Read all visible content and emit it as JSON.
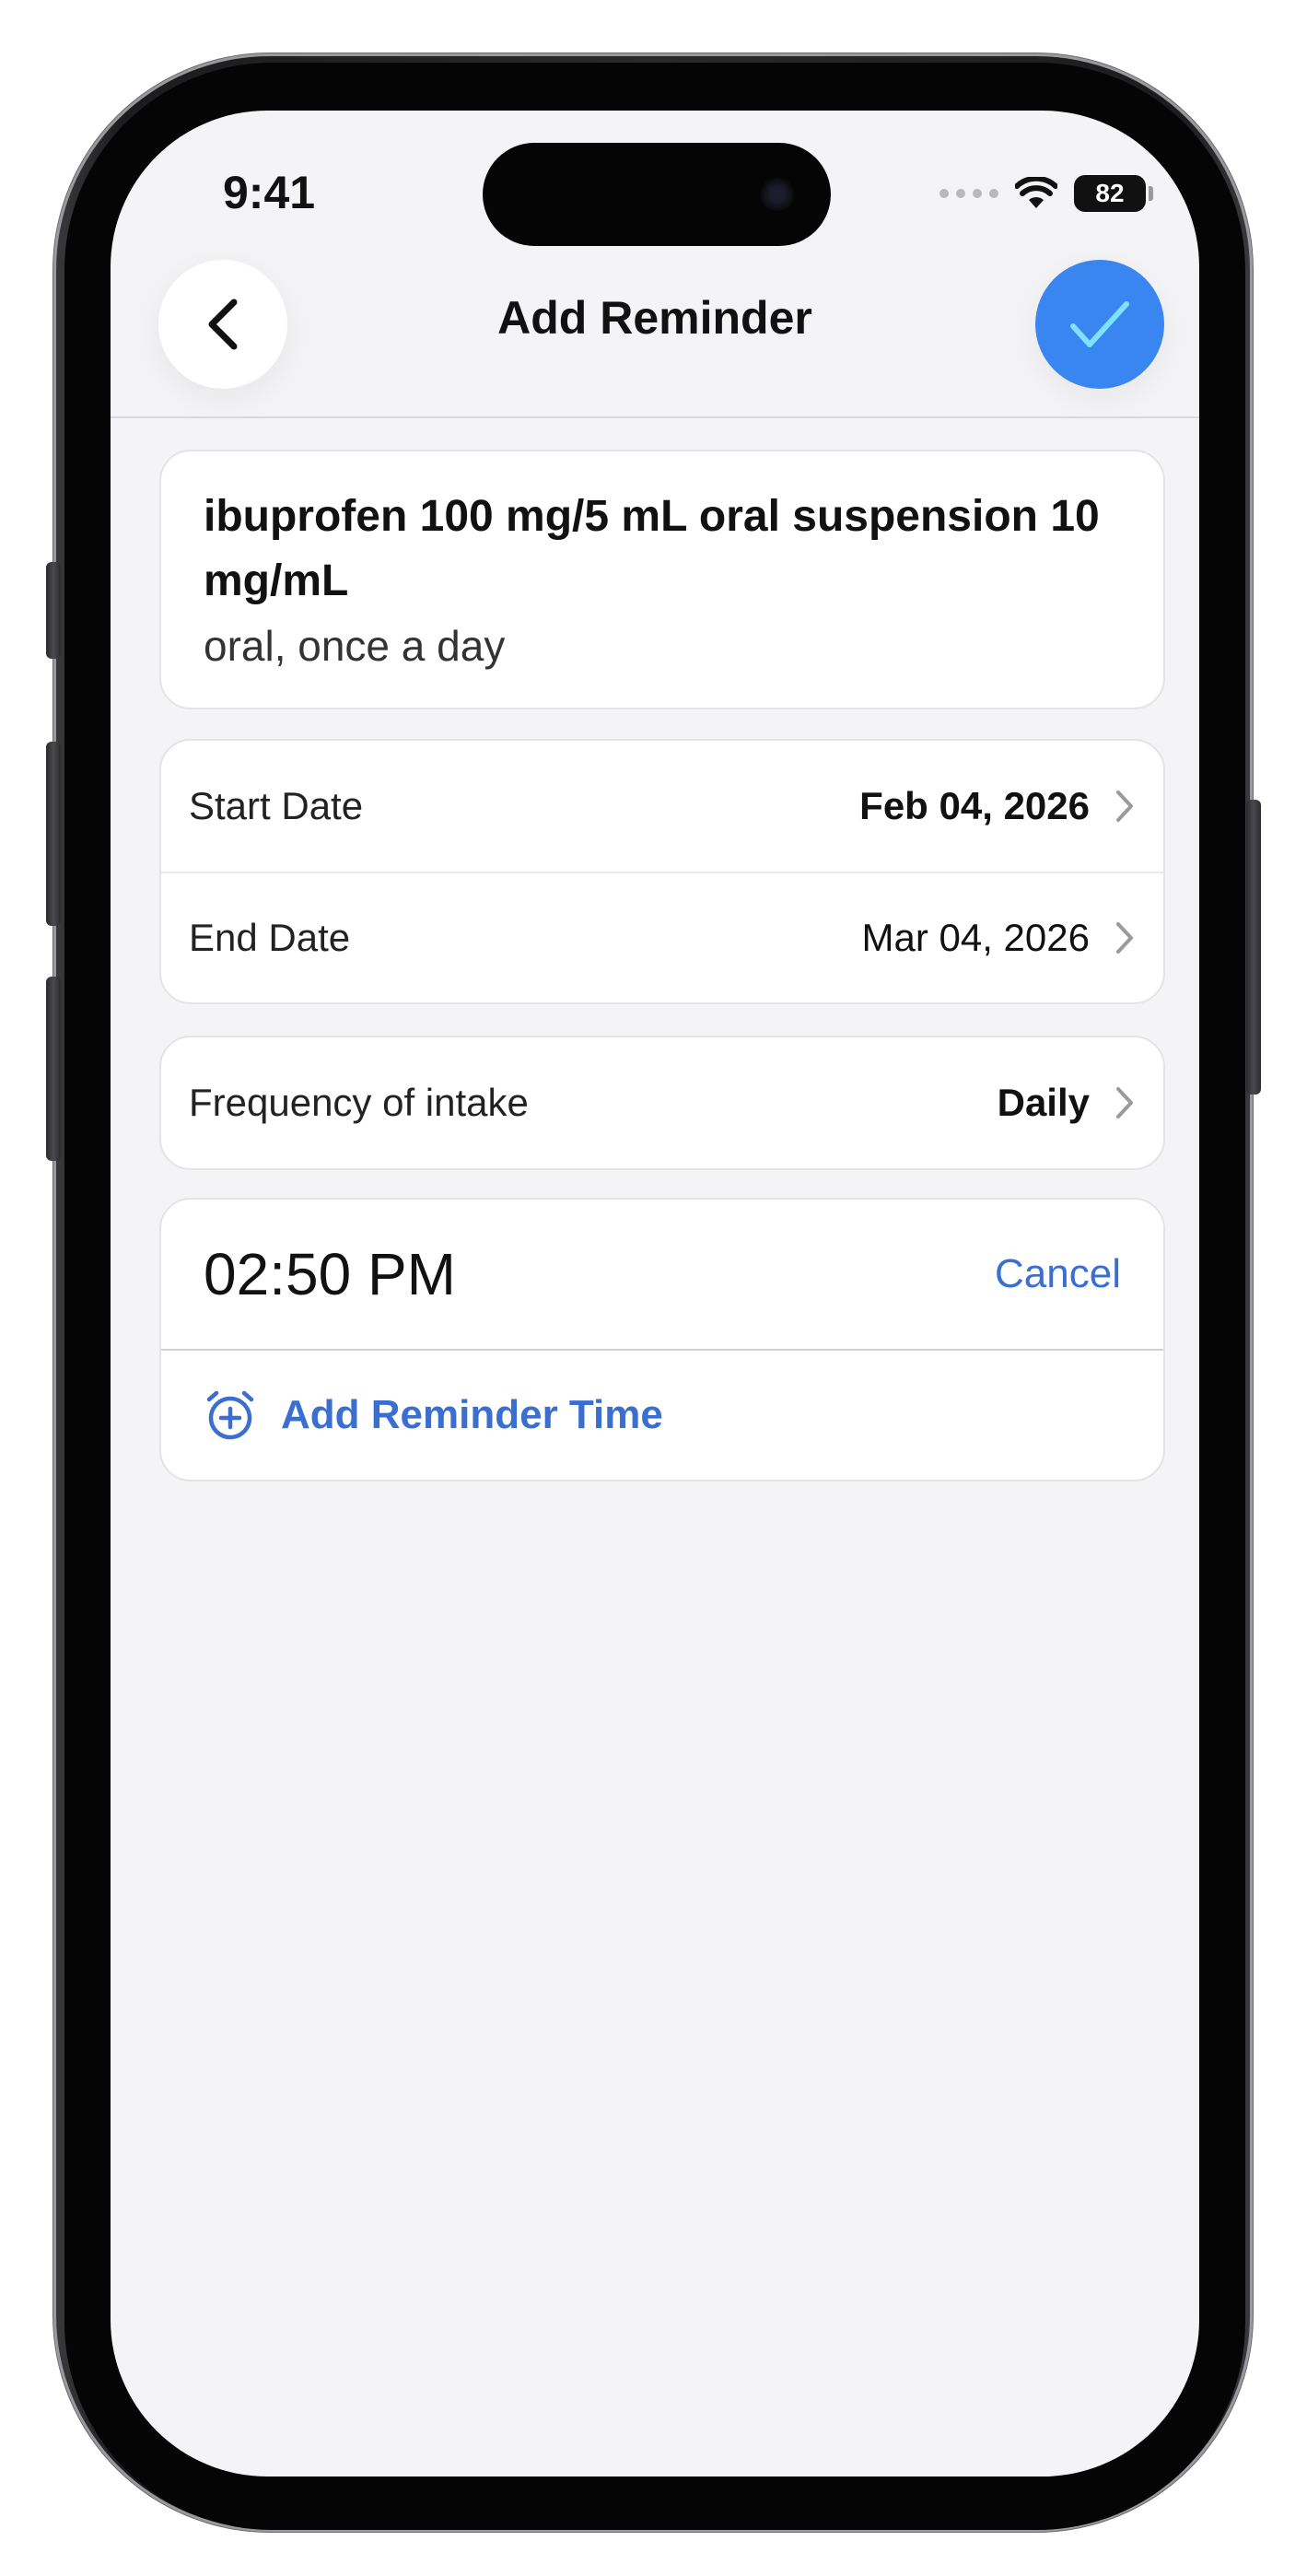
{
  "status_bar": {
    "time": "9:41",
    "battery": "82"
  },
  "nav": {
    "title": "Add Reminder",
    "back_icon": "chevron-left-icon",
    "confirm_icon": "checkmark-icon",
    "accent_color": "#3a86f0"
  },
  "medication": {
    "name": "ibuprofen 100 mg/5 mL oral suspension 10 mg/mL",
    "detail": "oral, once a day"
  },
  "dates": {
    "start_label": "Start Date",
    "start_value": "Feb 04, 2026",
    "end_label": "End Date",
    "end_value": "Mar 04, 2026"
  },
  "frequency": {
    "label": "Frequency of intake",
    "value": "Daily"
  },
  "reminders": {
    "times": [
      "02:50 PM"
    ],
    "cancel_label": "Cancel",
    "add_label": "Add Reminder Time",
    "link_color": "#3a6fd0"
  }
}
